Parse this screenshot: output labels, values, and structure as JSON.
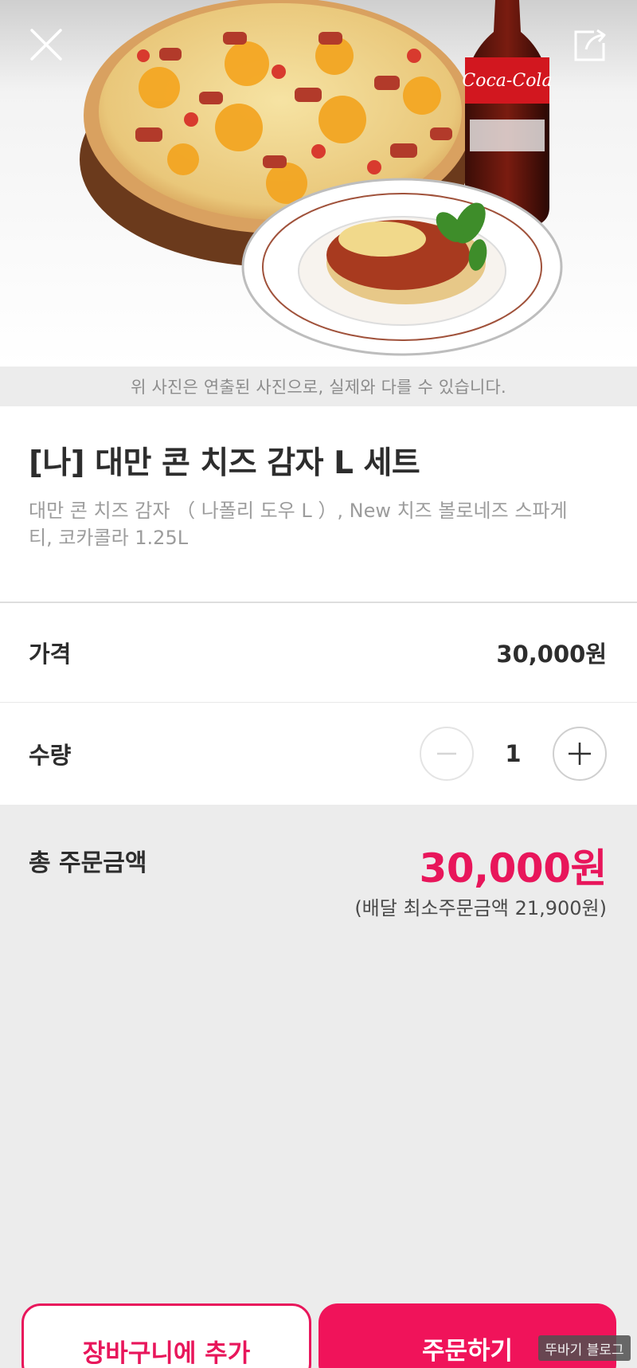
{
  "header": {
    "close_icon": "close-icon",
    "share_icon": "share-icon",
    "hero_image": "pizza-spaghetti-cola-set-photo",
    "coke_label": "Coca-Cola"
  },
  "notice": "위 사진은 연출된 사진으로, 실제와 다를 수 있습니다.",
  "product": {
    "title": "[나] 대만 콘 치즈 감자 L 세트",
    "description": "대만 콘 치즈 감자 （ 나폴리 도우 L ）, New 치즈 볼로네즈 스파게티, 코카콜라 1.25L"
  },
  "price": {
    "label": "가격",
    "value": "30,000원"
  },
  "quantity": {
    "label": "수량",
    "value": "1",
    "minus_icon": "minus-icon",
    "plus_icon": "plus-icon"
  },
  "total": {
    "label": "총 주문금액",
    "value": "30,000원",
    "min_order": "(배달 최소주문금액 21,900원)"
  },
  "actions": {
    "add_to_cart": "장바구니에 추가",
    "order": "주문하기"
  },
  "watermark": "뚜바기 블로그",
  "colors": {
    "accent": "#e8165b",
    "background": "#ececec"
  }
}
